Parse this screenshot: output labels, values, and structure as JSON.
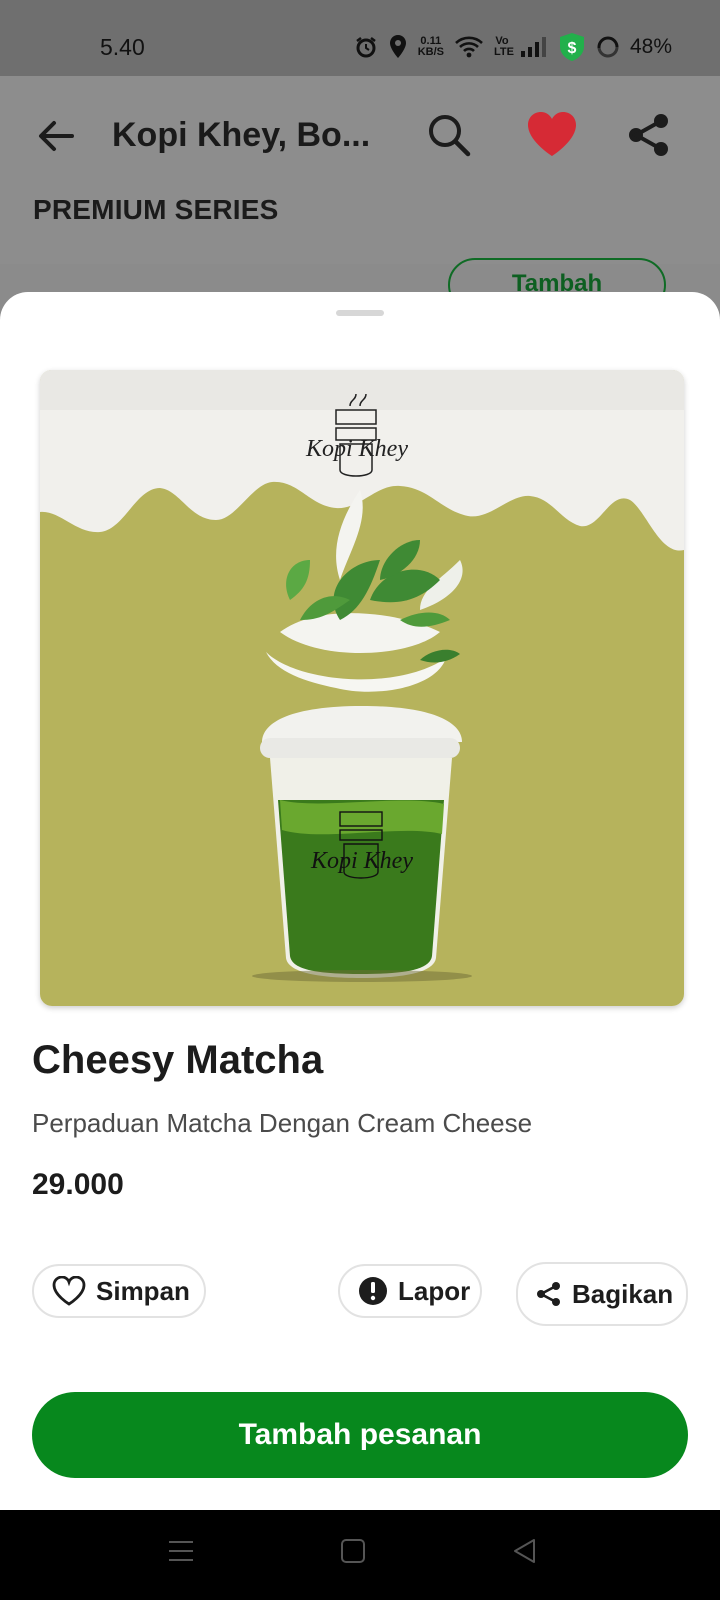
{
  "status_bar": {
    "time": "5.40",
    "net_speed_value": "0.11",
    "net_speed_unit": "KB/S",
    "volte": "Vo LTE",
    "battery": "48%",
    "icons": [
      "alarm-icon",
      "location-icon",
      "wifi-icon",
      "signal-icon",
      "shield-dollar-icon",
      "battery-ring-icon"
    ]
  },
  "header": {
    "title": "Kopi Khey, Bo...",
    "section_title": "PREMIUM SERIES",
    "behind_button": "Tambah",
    "heart_color": "#d62a35"
  },
  "product": {
    "image_brand": "Kopi Khey",
    "name": "Cheesy Matcha",
    "description": "Perpaduan Matcha Dengan Cream Cheese",
    "price": "29.000"
  },
  "actions": {
    "save": "Simpan",
    "report": "Lapor",
    "share": "Bagikan"
  },
  "cta": {
    "label": "Tambah pesanan",
    "color": "#07881d"
  },
  "nav_bar": {
    "icons": [
      "menu-icon",
      "home-square-icon",
      "back-triangle-icon"
    ]
  }
}
